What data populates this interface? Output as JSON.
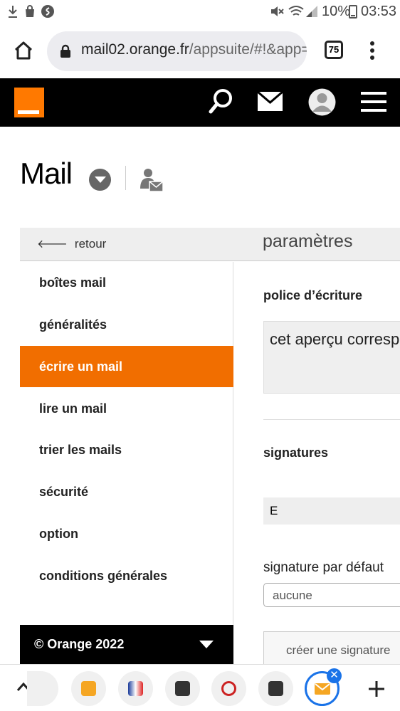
{
  "status_bar": {
    "battery": "10%",
    "time": "03:53"
  },
  "browser": {
    "url_host": "mail02.orange.fr",
    "url_path": "/appsuite/#!&app=",
    "tab_count": "75"
  },
  "header": {
    "brand_color": "#ff7900"
  },
  "page": {
    "title": "Mail"
  },
  "settings": {
    "back_label": "retour",
    "title": "paramètres"
  },
  "sidenav": {
    "items": [
      {
        "label": "boîtes mail",
        "active": false
      },
      {
        "label": "généralités",
        "active": false
      },
      {
        "label": "écrire un mail",
        "active": true
      },
      {
        "label": "lire un mail",
        "active": false
      },
      {
        "label": "trier les mails",
        "active": false
      },
      {
        "label": "sécurité",
        "active": false
      },
      {
        "label": "option",
        "active": false
      },
      {
        "label": "conditions générales",
        "active": false
      }
    ],
    "active_color": "#f16e00"
  },
  "footer": {
    "text": "© Orange 2022"
  },
  "content": {
    "font_heading": "police d’écriture",
    "font_preview": "cet aperçu correspond",
    "signatures_heading": "signatures",
    "signature_entry": "E",
    "default_signature_label": "signature par défaut",
    "default_signature_value": "aucune",
    "create_signature_label": "créer une signature"
  },
  "icons": [
    "download-icon",
    "shopping-bag-icon",
    "shazam-icon",
    "mute-icon",
    "wifi-icon",
    "signal-icon",
    "battery-icon",
    "home-icon",
    "lock-icon",
    "more-vert-icon",
    "search-icon",
    "envelope-icon",
    "user-avatar-icon",
    "hamburger-menu-icon",
    "chevron-down-icon",
    "contact-mail-icon",
    "arrow-left-icon"
  ]
}
